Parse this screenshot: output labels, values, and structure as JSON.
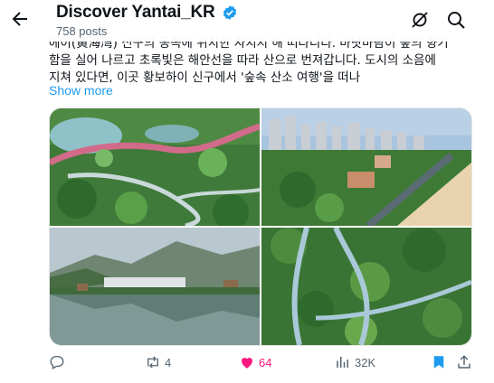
{
  "header": {
    "account_name": "Discover Yantai_KR",
    "posts_count": "758 posts"
  },
  "post": {
    "text_lines": [
      "에이(黄海湾) 신구의 동쪽에 위치한 자치지 해 떠다니다. 바닷바람이 숲의 향기",
      "함을 실어 나르고 초록빛은 해안선을 따라 산으로 번져갑니다. 도시의 소음에",
      "지쳐 있다면, 이곳 황보하이 신구에서 '숲속 산소 여행'을 떠나"
    ],
    "show_more": "Show more"
  },
  "actions": {
    "reply_count": "",
    "repost_count": "4",
    "like_count": "64",
    "views_count": "32K"
  },
  "colors": {
    "accent": "#1d9bf0",
    "like": "#f91880",
    "muted": "#536471"
  },
  "icons": [
    "back-arrow-icon",
    "verified-badge-icon",
    "grok-icon",
    "search-icon",
    "reply-icon",
    "repost-icon",
    "like-heart-icon",
    "views-icon",
    "bookmark-icon",
    "share-icon"
  ]
}
